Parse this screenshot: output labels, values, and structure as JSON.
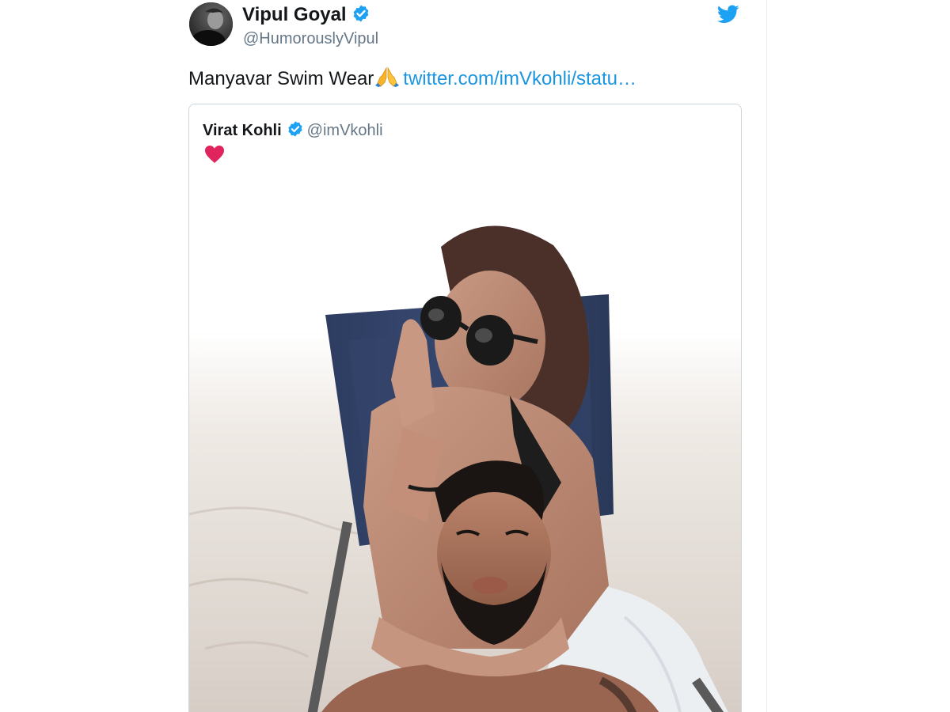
{
  "tweet": {
    "author_name": "Vipul Goyal",
    "author_handle": "@HumorouslyVipul",
    "text": "Manyavar Swim Wear",
    "link_text": "twitter.com/imVkohli/statu…",
    "avatar_icon": "avatar-photo",
    "verified_icon": "verified-badge-icon",
    "brand_icon": "twitter-bird-icon",
    "emoji_icon": "folded-hands-emoji"
  },
  "quoted_tweet": {
    "author_name": "Virat Kohli",
    "author_handle": "@imVkohli",
    "verified_icon": "verified-badge-icon",
    "emoji_icon": "red-heart-emoji",
    "media_description": "photo"
  },
  "colors": {
    "link": "#1b95e0",
    "verified": "#1da1f2",
    "heart": "#e0245e",
    "border": "#ccd6dd",
    "secondary_text": "#657786"
  }
}
